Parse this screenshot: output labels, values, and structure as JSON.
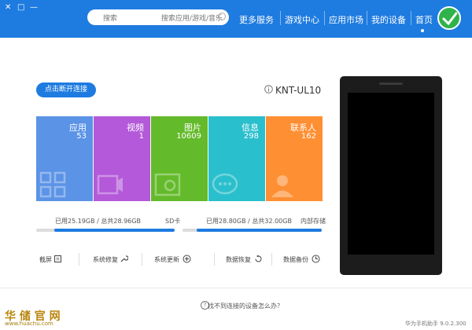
{
  "window": {
    "min": "—",
    "max": "□",
    "close": "✕"
  },
  "search": {
    "placeholder": "搜索应用/游戏/音乐",
    "button_label": "搜索"
  },
  "nav": {
    "items": [
      {
        "label": "首页"
      },
      {
        "label": "我的设备"
      },
      {
        "label": "应用市场"
      },
      {
        "label": "游戏中心"
      },
      {
        "label": "更多服务"
      }
    ],
    "active": 0
  },
  "device": {
    "model": "KNT-UL10",
    "open_button": "点击断开连接",
    "tiles": [
      {
        "name": "联系人",
        "count": "162",
        "color": "#ff8f33"
      },
      {
        "name": "信息",
        "count": "298",
        "color": "#2abfcc"
      },
      {
        "name": "图片",
        "count": "10609",
        "color": "#63ba2a"
      },
      {
        "name": "视频",
        "count": "1",
        "color": "#b359d9"
      },
      {
        "name": "应用",
        "count": "53",
        "color": "#5b93e6"
      }
    ],
    "storage": {
      "internal": {
        "label": "内部存储",
        "used": "已用28.80GB / 总共32.00GB",
        "fraction": 0.9
      },
      "sd": {
        "label": "SD卡",
        "used": "已用25.19GB / 总共28.96GB",
        "fraction": 0.87
      }
    }
  },
  "tools": [
    {
      "label": "数据备份",
      "icon": "backup-icon"
    },
    {
      "label": "数据恢复",
      "icon": "restore-icon"
    },
    {
      "label": "系统更新",
      "icon": "update-icon"
    },
    {
      "label": "系统修复",
      "icon": "repair-icon"
    },
    {
      "label": "截屏",
      "icon": "screenshot-icon"
    }
  ],
  "footer": {
    "help": "找不到连接的设备怎么办？",
    "version": "华为手机助手 9.0.2.300"
  },
  "watermark": {
    "main": "华 储 官 网",
    "sub": "www.huachu.com"
  },
  "colors": {
    "brand": "#1e7be0"
  }
}
